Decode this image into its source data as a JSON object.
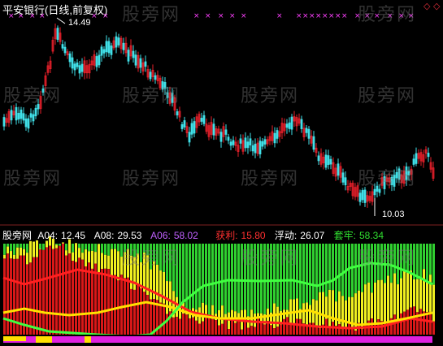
{
  "header": {
    "title": "平安银行(日线,前复权)",
    "corner_icons": [
      "diamond-icon",
      "diamond-icon"
    ]
  },
  "watermark": "股旁网",
  "price_chart": {
    "high_label": "14.49",
    "low_label": "10.03",
    "colors": {
      "up": "#e8202a",
      "down": "#40e0e8",
      "marker": "#ff40ff"
    }
  },
  "indicator": {
    "name": "股旁网",
    "fields": [
      {
        "key": "A04",
        "label": "A04:",
        "value": "12.45",
        "color": "#ffffff"
      },
      {
        "key": "A08",
        "label": "A08:",
        "value": "29.53",
        "color": "#ffffff"
      },
      {
        "key": "A06",
        "label": "A06:",
        "value": "58.02",
        "color": "#c060ff"
      },
      {
        "key": "profit",
        "label": "获利:",
        "value": "15.80",
        "color": "#ff3030"
      },
      {
        "key": "float",
        "label": "浮动:",
        "value": "26.07",
        "color": "#ffffff"
      },
      {
        "key": "trapped",
        "label": "套牢:",
        "value": "58.34",
        "color": "#30e030"
      }
    ],
    "colors": {
      "profit": "#d81818",
      "float": "#f0f020",
      "trapped": "#30d030",
      "line_red": "#ff2020",
      "line_yellow": "#ffe000",
      "line_green": "#40ff40"
    }
  }
}
